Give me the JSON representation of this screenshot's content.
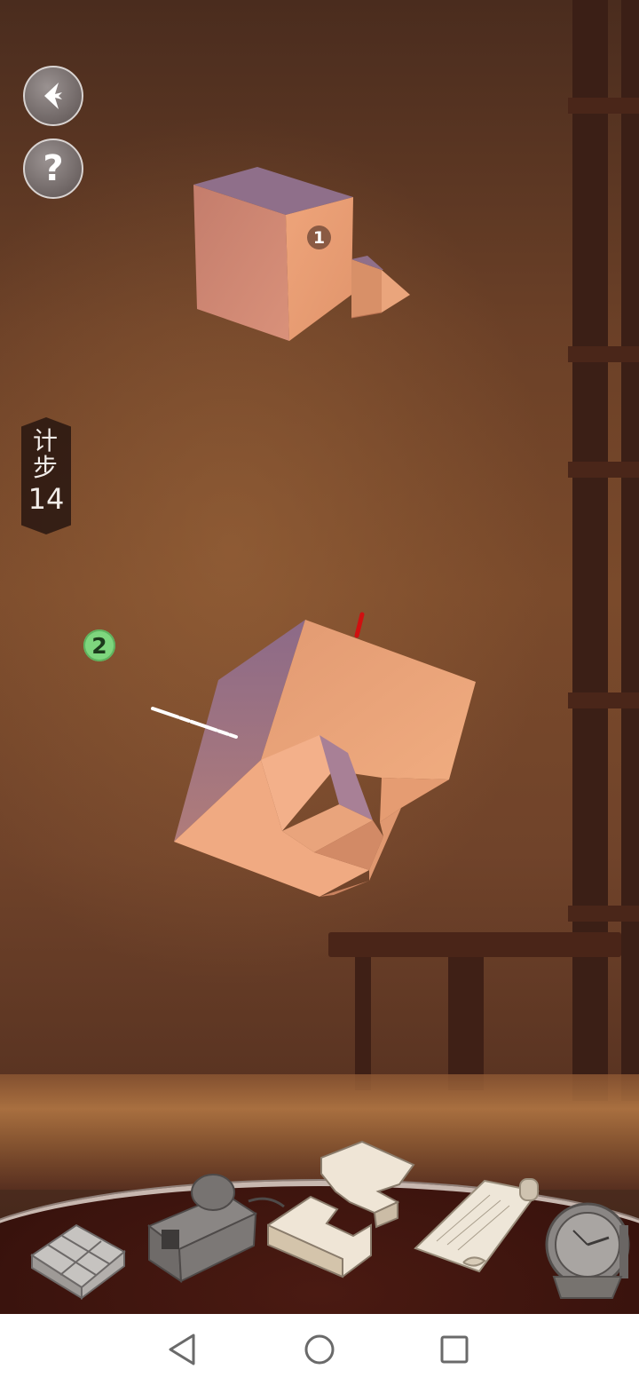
{
  "header": {
    "back_button_icon": "back-arrow-icon",
    "help_button_label": "?"
  },
  "step_counter": {
    "label": "计步",
    "label_line1": "计",
    "label_line2": "步",
    "count": "14"
  },
  "pieces": [
    {
      "marker": "1",
      "marker_color": "#8a5a43"
    },
    {
      "marker": "2",
      "marker_color": "#7ed67e"
    }
  ],
  "toolbar": {
    "tools": [
      {
        "icon": "compartment-box-icon"
      },
      {
        "icon": "carpenter-plane-icon"
      },
      {
        "icon": "puzzle-pieces-icon"
      },
      {
        "icon": "scroll-icon"
      },
      {
        "icon": "compass-meter-icon"
      }
    ]
  },
  "nav": {
    "back_icon": "triangle-back-icon",
    "home_icon": "circle-home-icon",
    "recents_icon": "square-recents-icon"
  },
  "colors": {
    "wood_light": "#e39a70",
    "wood_shadow": "#8f6a86",
    "accent_green": "#7ed67e"
  }
}
